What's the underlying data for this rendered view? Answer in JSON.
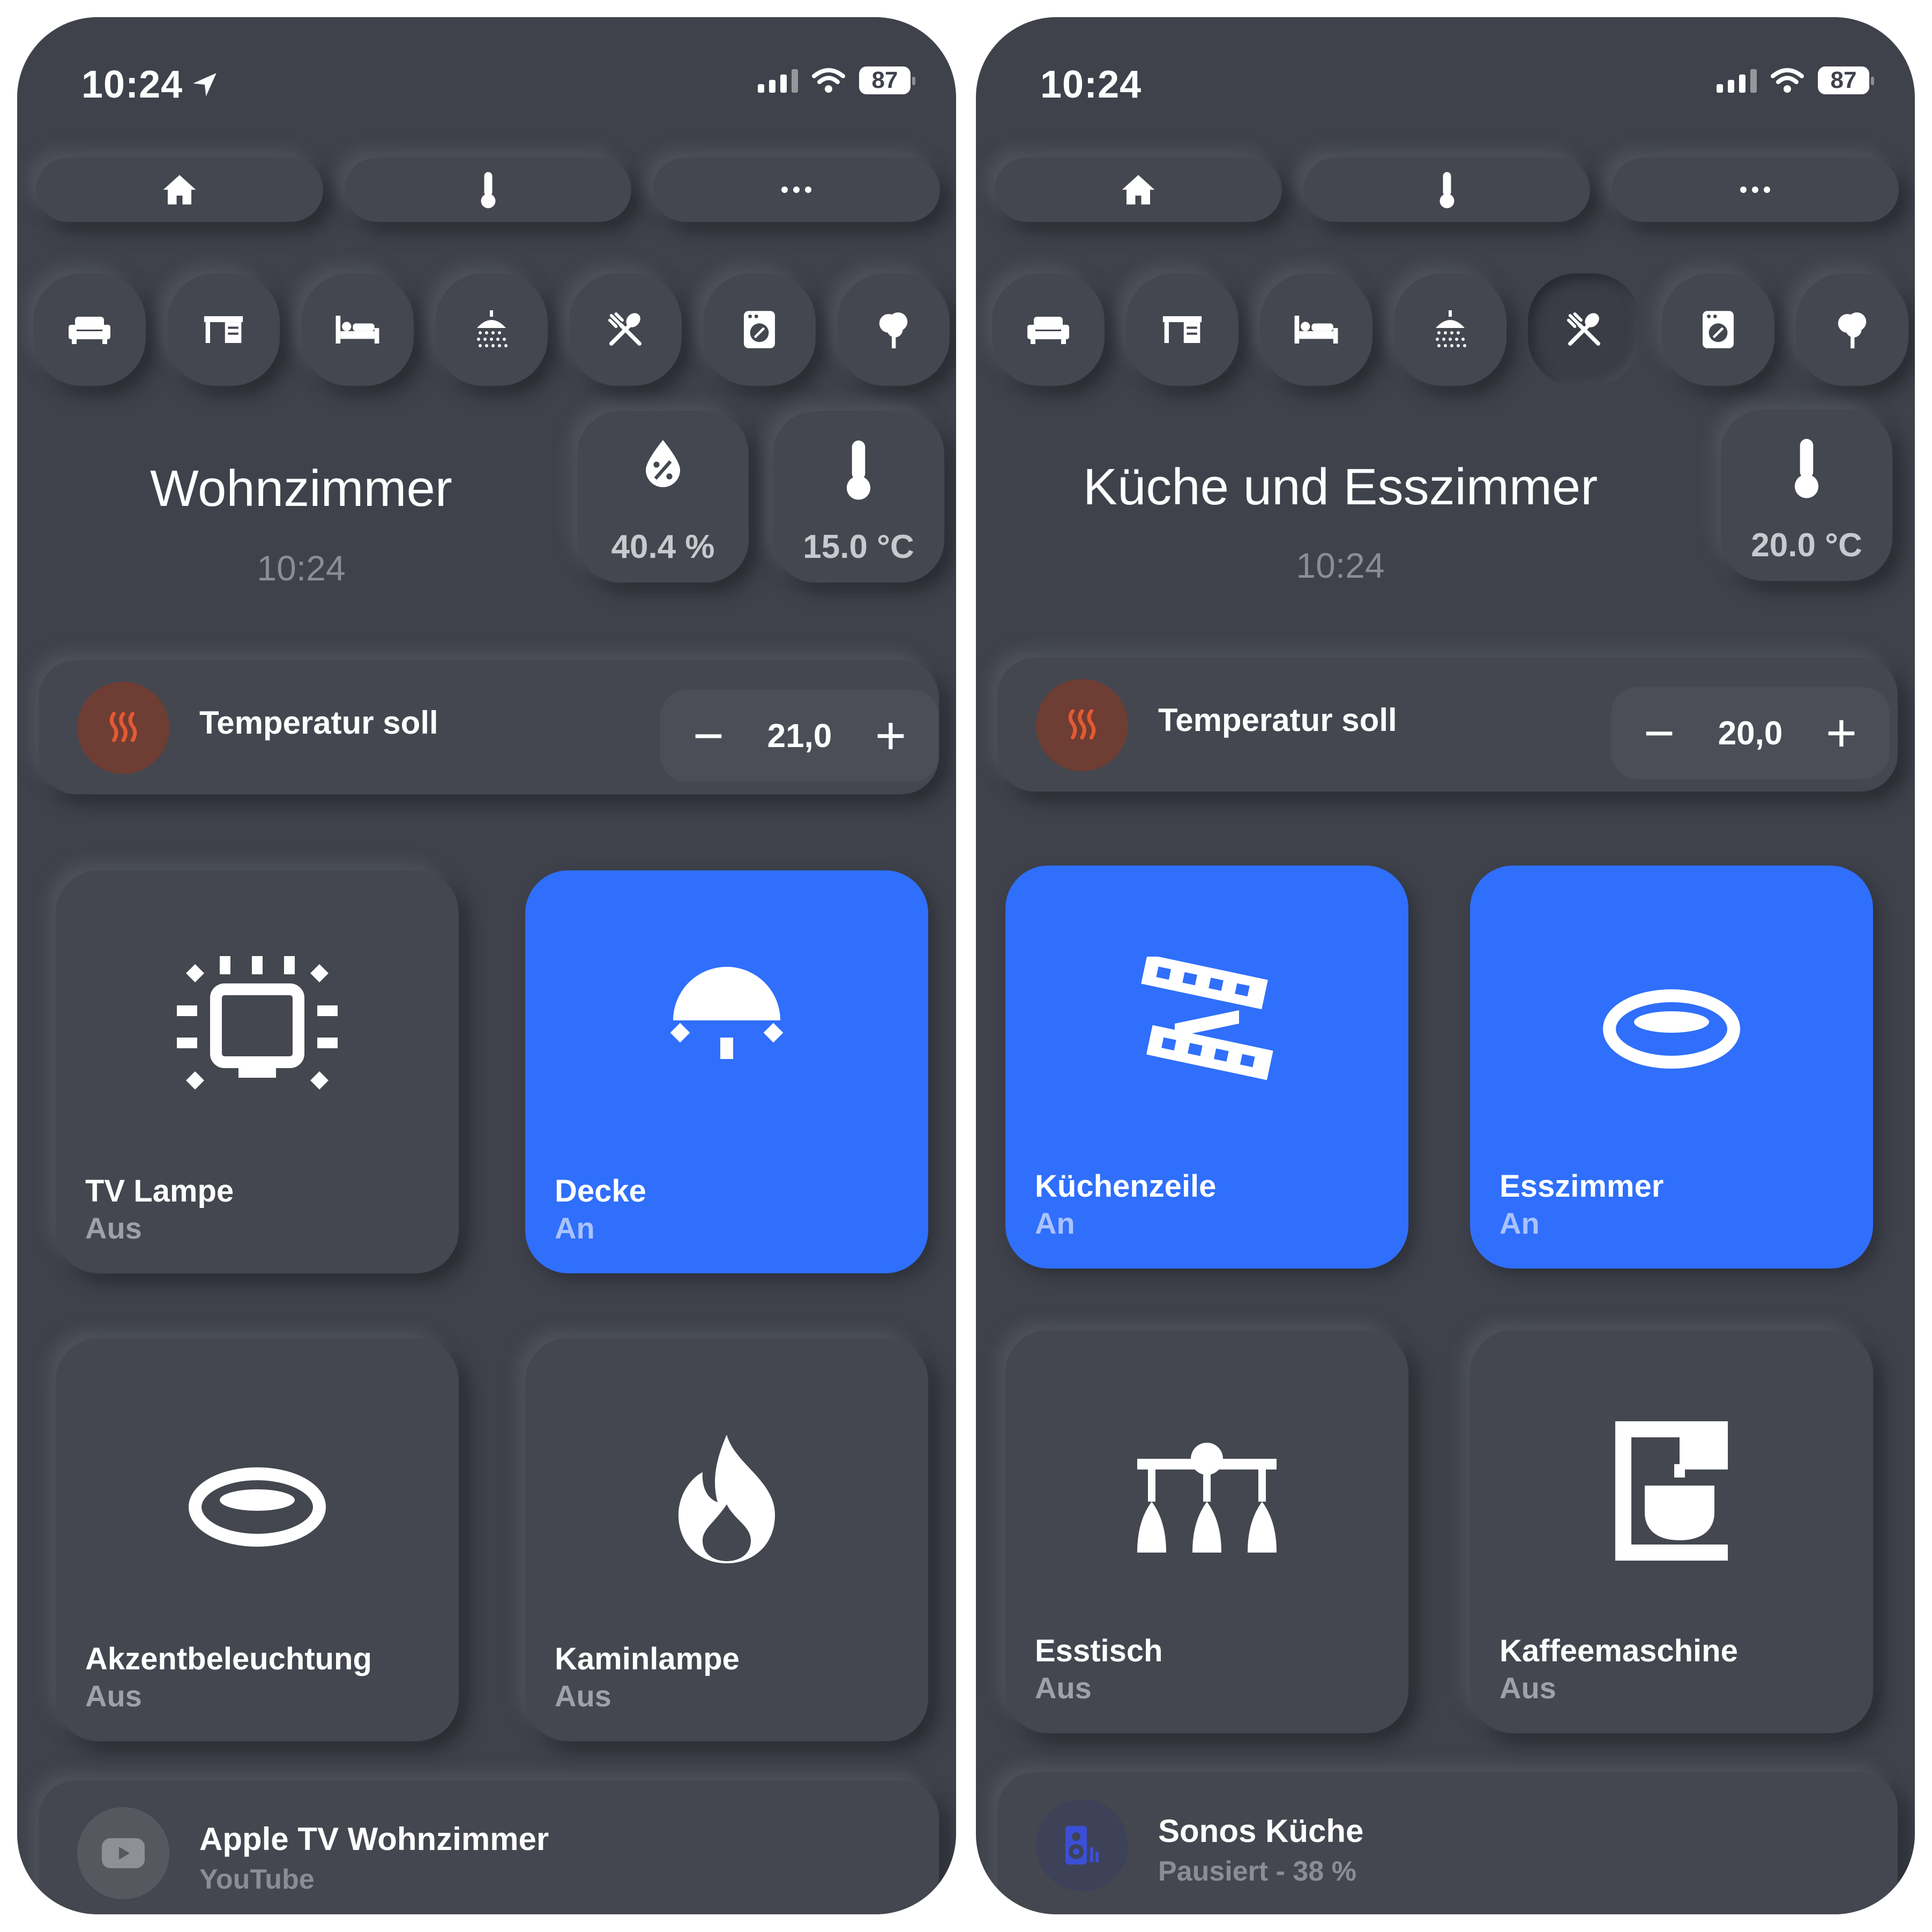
{
  "colors": {
    "background": "#3f424b",
    "accent_blue": "#2f6ffb",
    "heat_orange": "#e35a33",
    "text_muted": "#8a8d95"
  },
  "left": {
    "status": {
      "time": "10:24",
      "battery": "87"
    },
    "tabs": [
      "home-icon",
      "thermometer-icon",
      "more-icon"
    ],
    "rooms": [
      "sofa-icon",
      "desk-icon",
      "bed-icon",
      "shower-icon",
      "dining-icon",
      "washer-icon",
      "tree-icon"
    ],
    "room": {
      "title": "Wohnzimmer",
      "time": "10:24"
    },
    "sensors": {
      "humidity": "40.4 %",
      "temperature": "15.0 °C"
    },
    "thermostat": {
      "label": "Temperatur soll",
      "value": "21,0",
      "minus": "−",
      "plus": "+"
    },
    "tiles": [
      {
        "name": "TV Lampe",
        "state": "Aus",
        "on": false,
        "icon": "tv-light-icon"
      },
      {
        "name": "Decke",
        "state": "An",
        "on": true,
        "icon": "ceiling-light-icon"
      },
      {
        "name": "Akzentbeleuchtung",
        "state": "Aus",
        "on": false,
        "icon": "ring-light-icon"
      },
      {
        "name": "Kaminlampe",
        "state": "Aus",
        "on": false,
        "icon": "fire-icon"
      }
    ],
    "media": {
      "title": "Apple TV Wohnzimmer",
      "subtitle": "YouTube",
      "icon": "youtube-icon"
    }
  },
  "right": {
    "status": {
      "time": "10:24",
      "battery": "87"
    },
    "tabs": [
      "home-icon",
      "thermometer-icon",
      "more-icon"
    ],
    "rooms": [
      "sofa-icon",
      "desk-icon",
      "bed-icon",
      "shower-icon",
      "dining-icon",
      "washer-icon",
      "tree-icon"
    ],
    "room": {
      "title": "Küche und Esszimmer",
      "time": "10:24"
    },
    "sensors": {
      "temperature": "20.0 °C"
    },
    "thermostat": {
      "label": "Temperatur soll",
      "value": "20,0",
      "minus": "−",
      "plus": "+"
    },
    "tiles": [
      {
        "name": "Küchenzeile",
        "state": "An",
        "on": true,
        "icon": "led-strip-icon"
      },
      {
        "name": "Esszimmer",
        "state": "An",
        "on": true,
        "icon": "ring-light-icon"
      },
      {
        "name": "Esstisch",
        "state": "Aus",
        "on": false,
        "icon": "pendant-lights-icon"
      },
      {
        "name": "Kaffeemaschine",
        "state": "Aus",
        "on": false,
        "icon": "coffee-machine-icon"
      }
    ],
    "media": {
      "title": "Sonos Küche",
      "subtitle": "Pausiert - 38 %",
      "icon": "speaker-icon"
    }
  }
}
